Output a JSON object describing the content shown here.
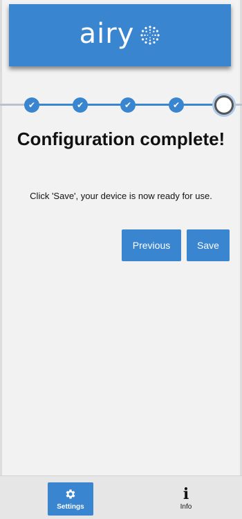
{
  "header": {
    "logo_text": "airy"
  },
  "stepper": {
    "completed_mark": "✔",
    "total_steps": 5,
    "completed_steps": 4,
    "current_step": 5
  },
  "main": {
    "title": "Configuration complete!",
    "message": "Click 'Save', your device is now ready for use."
  },
  "buttons": {
    "previous_label": "Previous",
    "save_label": "Save"
  },
  "bottom_nav": {
    "settings_label": "Settings",
    "info_label": "Info",
    "settings_icon": "gear-icon",
    "info_icon": "info-icon",
    "active": "Settings"
  },
  "colors": {
    "accent": "#3a85d0",
    "background": "#f2f2f2"
  }
}
